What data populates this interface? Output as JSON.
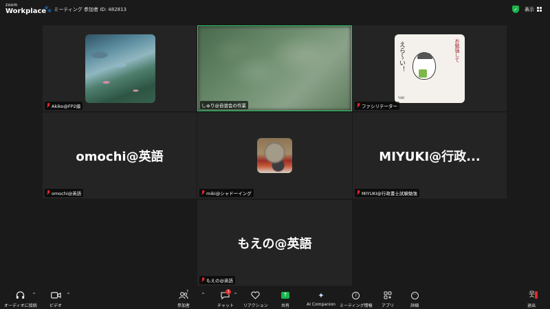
{
  "app": {
    "logo_small": "zoom",
    "logo_big": "Workplace",
    "meeting_label": "ミーティング 参加者 ID: 482813",
    "view_label": "表示"
  },
  "colors": {
    "accent_green": "#19b34a",
    "muted_red": "#e02828",
    "active_speaker_border": "#2fd06a",
    "tile_bg": "#242424"
  },
  "tiles": [
    {
      "name": "Akiko@FP2級",
      "type": "image",
      "image": "water-lilies-painting",
      "muted": true,
      "active": false
    },
    {
      "name": "しゅり@自習会の作業",
      "type": "video",
      "image": "blurred-video",
      "muted": false,
      "active": true
    },
    {
      "name": "ファシリテーター",
      "type": "image",
      "image": "bird-sketch",
      "muted": true,
      "active": false
    },
    {
      "name": "omochi@英語",
      "type": "text",
      "big_text": "omochi@英語",
      "muted": true,
      "active": false
    },
    {
      "name": "miki@シャドーイング",
      "type": "image",
      "image": "rock-photo",
      "muted": true,
      "active": false
    },
    {
      "name": "MIYUKI@行政書士試験勉強",
      "type": "text",
      "big_text": "MIYUKI@行政...",
      "muted": true,
      "active": false
    },
    {
      "name": "もえの@英語",
      "type": "text",
      "big_text": "もえの@英語",
      "muted": true,
      "active": false
    }
  ],
  "sketch": {
    "left_text": "えら〜い！",
    "right_text": "お勉強して"
  },
  "toolbar": {
    "audio": {
      "label": "オーディオに接続",
      "icon": "headphones-icon"
    },
    "video": {
      "label": "ビデオ",
      "icon": "video-camera-icon"
    },
    "participants": {
      "label": "参加者",
      "icon": "participants-icon",
      "count": "7"
    },
    "chat": {
      "label": "チャット",
      "icon": "chat-icon",
      "badge": "1"
    },
    "reactions": {
      "label": "リアクション",
      "icon": "heart-icon"
    },
    "share": {
      "label": "共有",
      "icon": "share-arrow-icon"
    },
    "ai": {
      "label": "AI Companion",
      "icon": "sparkle-icon"
    },
    "info": {
      "label": "ミーティング情報",
      "icon": "info-icon"
    },
    "apps": {
      "label": "アプリ",
      "icon": "apps-icon"
    },
    "more": {
      "label": "詳細",
      "icon": "more-icon"
    },
    "leave": {
      "label": "退出",
      "icon": "leave-icon"
    }
  }
}
